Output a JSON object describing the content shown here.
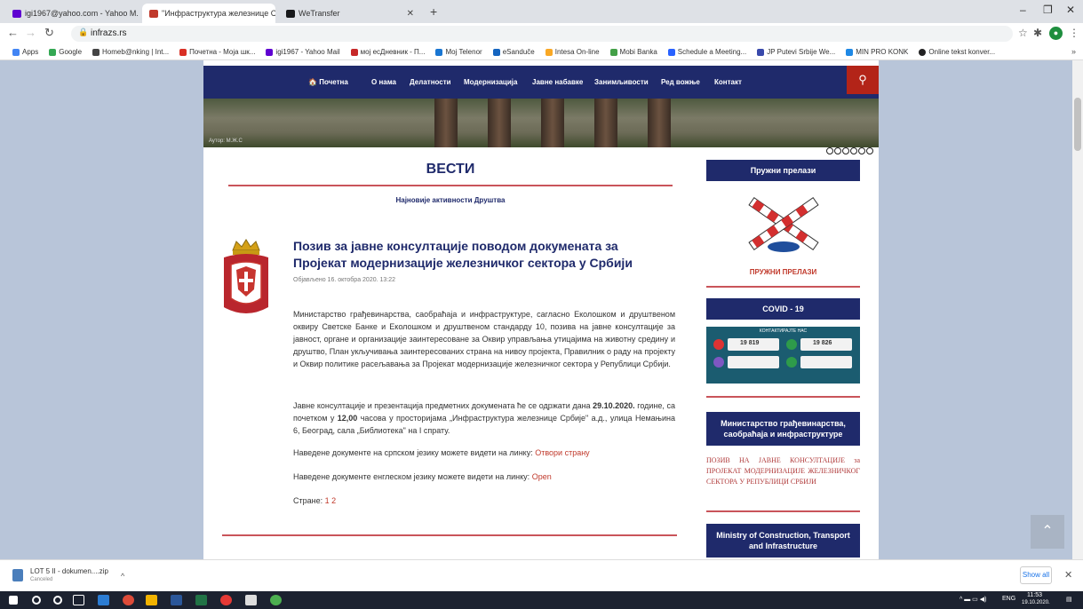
{
  "browser": {
    "tabs": [
      {
        "label": "igi1967@yahoo.com - Yahoo M...",
        "active": false
      },
      {
        "label": "\"Инфраструктура железнице С...",
        "active": true
      },
      {
        "label": "WeTransfer",
        "active": false
      }
    ],
    "new_tab": "+",
    "window_controls": {
      "minimize": "–",
      "restore": "❐",
      "close": "✕"
    },
    "url": "infrazs.rs",
    "bookmarks": [
      "Apps",
      "Google",
      "Homeb@nking | Int...",
      "Почетна - Моја шк...",
      "igi1967 - Yahoo Mail",
      "мој есДневник - П...",
      "Moj Telenor",
      "eSanduče",
      "Intesa On-line",
      "Mobi Banka",
      "Schedule a Meeting...",
      "JP Putevi Srbije We...",
      "MIN PRO KONK",
      "Online tekst konver..."
    ],
    "bookmarks_more": "»"
  },
  "site": {
    "nav": [
      "Почетна",
      "О нама",
      "Делатности",
      "Модернизација",
      "Јавне набавке",
      "Занимљивости",
      "Ред вожње",
      "Контакт"
    ],
    "hero_caption": "Аутор: М.Ж.С",
    "section_title": "ВЕСТИ",
    "section_subtitle": "Најновије активности Друштва",
    "article": {
      "title": "Позив за јавне консултације поводом докумената за Пројекат модернизације железничког сектора у Србији",
      "posted": "Објављено 16. октобра 2020. 13:22",
      "p1": "Министарство грађевинарства, саобраћаја и инфраструктуре, сагласно Еколошком и друштвеном оквиру Светске Банке и Еколошком и друштвеном стандарду 10, позива на јавне консултације за јавност, органе и организације заинтересоване за Оквир управљања утицајима на животну средину и друштво, План укључивања заинтересованих страна на нивоу пројекта, Правилник о раду на пројекту и Оквир политике расељавања за Пројекат модернизације железничког сектора у Републици Србији.",
      "p2_before": "Јавне консултације и презентација предметних докумената ће се одржати дана ",
      "p2_date": "29.10.2020.",
      "p2_mid": " године, са почетком у ",
      "p2_time": "12,00",
      "p2_after": " часова у просторијама „Инфраструктура железнице Србије\" а.д., улица Немањина 6, Београд, сала „Библиотека\" на I спрату.",
      "p3_text": "Наведене документе на српском језику можете видети на линку: ",
      "p3_link": "Отвори страну",
      "p4_text": "Наведене документе енглеском језику можете видети на линку: ",
      "p4_link": "Open",
      "pages_label": "Стране: ",
      "pages": "1 2"
    },
    "sidebar": {
      "crossings_title": "Пружни прелази",
      "crossings_logo_text": "ПРУЖНИ ПРЕЛАЗИ",
      "covid_title": "COVID - 19",
      "covid_banner_title": "КОНТАКТИРАЈТЕ НАС",
      "covid_numbers": [
        "19 819",
        "19 826"
      ],
      "ministry_title": "Министарство грађевинарства, саобраћаја и инфраструктуре",
      "ministry_link": "ПОЗИВ НА ЈАВНЕ КОНСУЛТАЦИЈЕ за ПРОЈЕКАТ МОДЕРНИЗАЦИЈЕ ЖЕЛЕЗНИЧКОГ СЕКТОРА У РЕПУБЛИЦИ СРБИЈИ",
      "ministry_en_title": "Ministry of Construction, Transport and Infrastructure"
    },
    "to_top": "⌃"
  },
  "downloads": {
    "file_name": "LOT 5 II - dokumen....zip",
    "status": "Canceled",
    "show_all": "Show all"
  },
  "taskbar": {
    "language": "ENG",
    "time": "11:53",
    "date": "19.10.2020."
  }
}
